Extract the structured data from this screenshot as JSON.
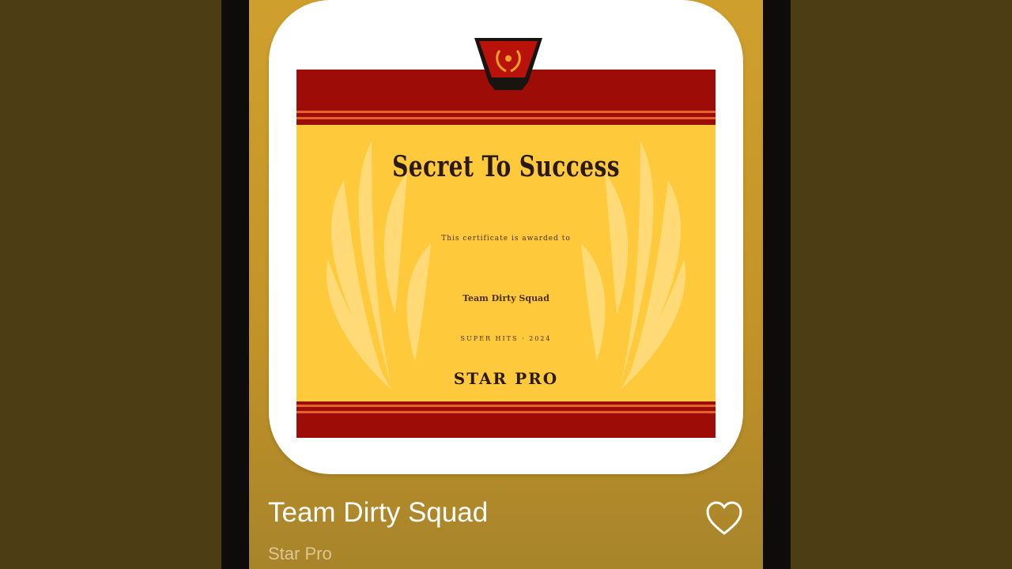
{
  "player": {
    "track_title": "Team Dirty Squad",
    "artist": "Star Pro",
    "like_icon": "heart-outline-icon"
  },
  "artwork": {
    "title": "Secret To Success",
    "awarded_text": "This certificate is awarded to",
    "recipient": "Team Dirty Squad",
    "date_line": "SUPER HITS · 2024",
    "signer": "STAR PRO"
  },
  "colors": {
    "background": "#4c3d14",
    "screen_gradient_top": "#cf9f2e",
    "certificate": "#ffc93c",
    "certificate_band": "#9e0c07"
  }
}
